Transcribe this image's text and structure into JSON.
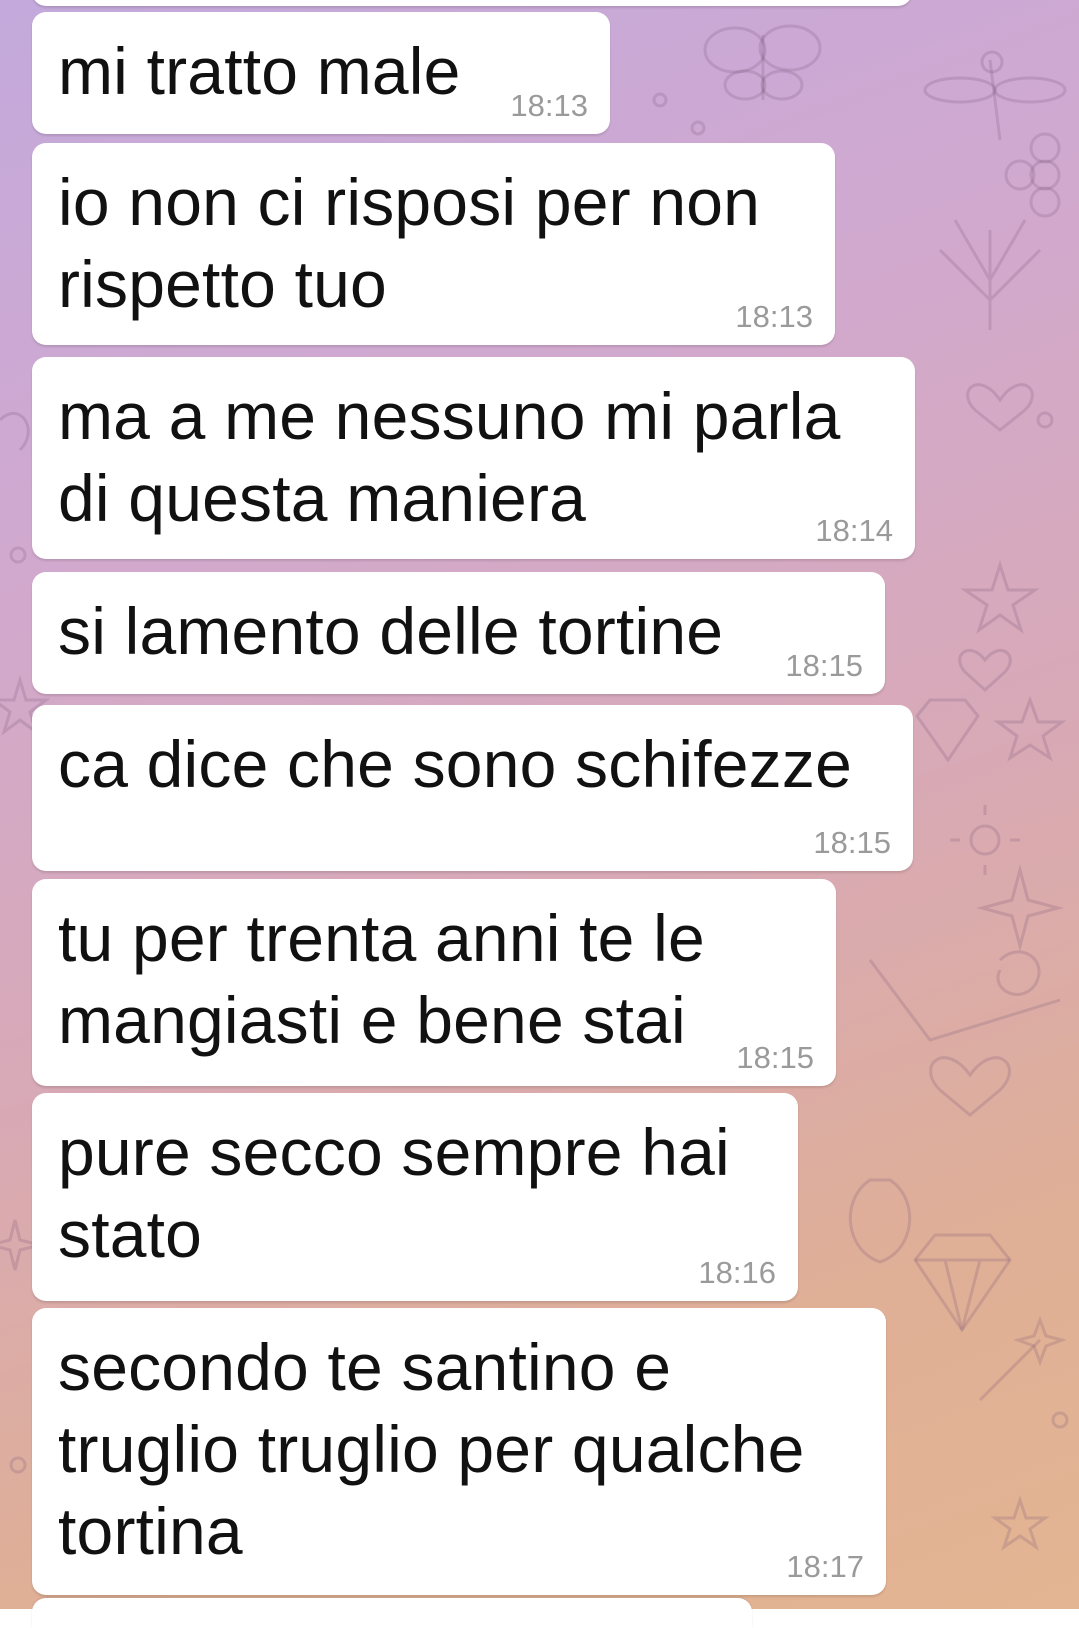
{
  "chat": {
    "messages": [
      {
        "text": "mi tratto male",
        "time": "18:13"
      },
      {
        "text": "io non ci risposi per non\nrispetto tuo",
        "time": "18:13"
      },
      {
        "text": "ma a me nessuno mi parla\ndi questa maniera",
        "time": "18:14"
      },
      {
        "text": "si lamento delle tortine",
        "time": "18:15"
      },
      {
        "text": "ca dice che sono schifezze",
        "time": "18:15"
      },
      {
        "text": "tu per trenta anni te le\nmangiasti e bene stai",
        "time": "18:15"
      },
      {
        "text": "pure secco sempre hai\nstato",
        "time": "18:16"
      },
      {
        "text": "secondo te santino e\ntruglio truglio per qualche\ntortina",
        "time": "18:17"
      }
    ]
  },
  "icons": {
    "background": [
      "butterfly-icon",
      "flower-icon",
      "heart-icon",
      "star-icon",
      "diamond-icon",
      "sun-icon",
      "leaf-icon",
      "sparkle-icon"
    ]
  },
  "colors": {
    "bubble": "#ffffff",
    "text": "#111111",
    "time": "#9a9a9a",
    "background_top": "#c3a9dc",
    "background_bottom": "#e3b592"
  }
}
